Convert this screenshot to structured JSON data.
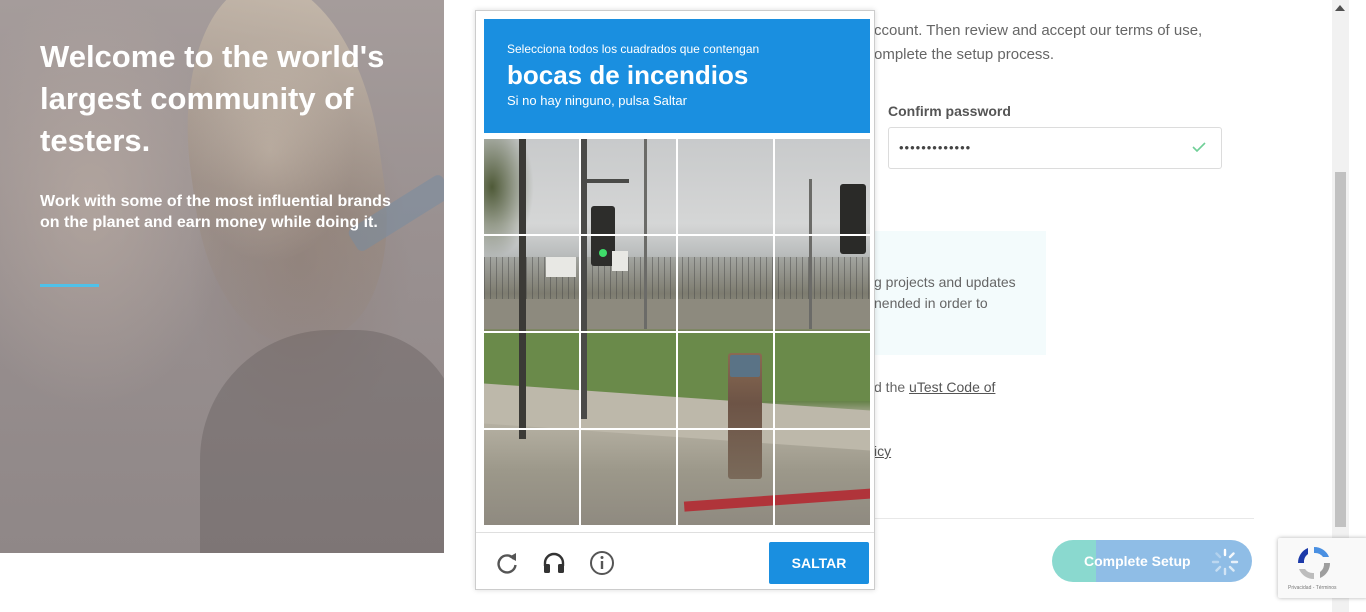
{
  "hero": {
    "title": "Welcome to the world's largest community of testers.",
    "subtitle": "Work with some of the most influential brands on the planet and earn money while doing it.",
    "accent_color": "#4fc1e9"
  },
  "form": {
    "intro_line1": "ccount. Then review and accept our terms of use,",
    "intro_line2": "omplete the setup process.",
    "confirm_password_label": "Confirm password",
    "confirm_password_value": "•••••••••••••",
    "info_line1": "g projects and updates",
    "info_line2": "nended in order to",
    "terms_prefix": "d the ",
    "terms_link": "uTest Code of",
    "privacy_link_fragment": "icy",
    "complete_button": "Complete Setup"
  },
  "captcha": {
    "instruction": "Selecciona todos los cuadrados que contengan",
    "target": "bocas de incendios",
    "hint": "Si no hay ninguno, pulsa Saltar",
    "skip_button": "SALTAR",
    "icons": [
      "reload-icon",
      "audio-headphones-icon",
      "info-icon"
    ],
    "grid_size": 4,
    "header_color": "#1a8fe0"
  },
  "recaptcha_badge": {
    "terms_text": "Privacidad - Términos"
  }
}
